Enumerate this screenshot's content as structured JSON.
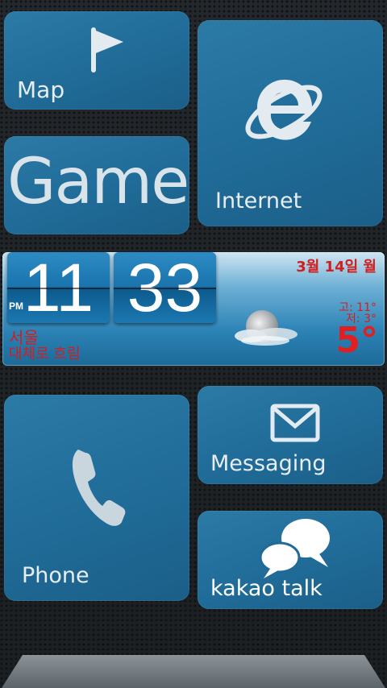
{
  "tiles": {
    "map": {
      "label": "Map",
      "icon": "flag-icon"
    },
    "internet": {
      "label": "Internet",
      "icon": "internet-explorer-icon"
    },
    "game": {
      "label": "Game"
    },
    "phone": {
      "label": "Phone",
      "icon": "phone-icon"
    },
    "messaging": {
      "label": "Messaging",
      "icon": "envelope-icon"
    },
    "kakao": {
      "label": "kakao talk",
      "icon": "chat-bubbles-icon"
    }
  },
  "clock": {
    "hours": "11",
    "minutes": "33",
    "ampm": "PM"
  },
  "weather": {
    "date": "3월 14일 월",
    "high": "고: 11°",
    "low": "저:  3°",
    "current_temp": "5°",
    "city": "서울",
    "condition": "대체로 흐림",
    "icon": "cloudy-moon-icon"
  },
  "colors": {
    "tile": "#1f6a96",
    "accent_red": "#d21e1e",
    "background": "#1e2226"
  }
}
